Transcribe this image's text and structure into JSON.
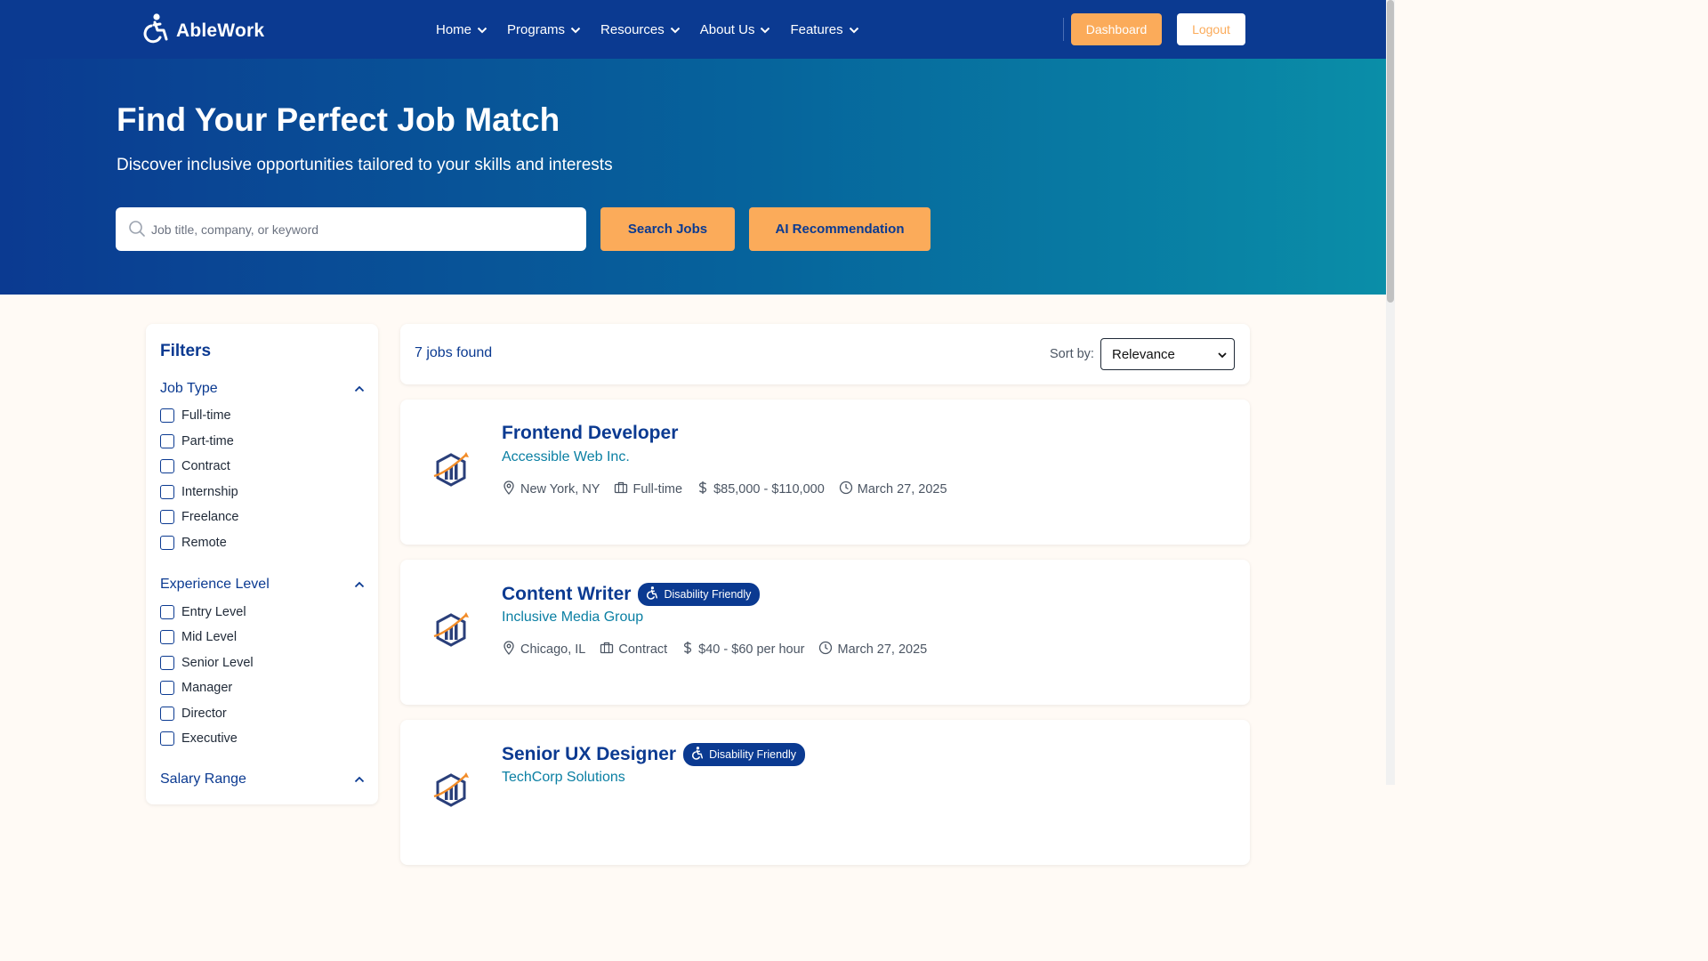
{
  "brand": {
    "name": "AbleWork",
    "icon": "accessibility-icon"
  },
  "nav": {
    "items": [
      {
        "label": "Home"
      },
      {
        "label": "Programs"
      },
      {
        "label": "Resources"
      },
      {
        "label": "About Us"
      },
      {
        "label": "Features"
      }
    ],
    "dashboard_label": "Dashboard",
    "logout_label": "Logout"
  },
  "hero": {
    "title": "Find Your Perfect Job Match",
    "subtitle": "Discover inclusive opportunities tailored to your skills and interests",
    "search_placeholder": "Job title, company, or keyword",
    "search_value": "",
    "search_button": "Search Jobs",
    "ai_button": "AI Recommendation"
  },
  "filters": {
    "title": "Filters",
    "groups": [
      {
        "title": "Job Type",
        "options": [
          "Full-time",
          "Part-time",
          "Contract",
          "Internship",
          "Freelance",
          "Remote"
        ]
      },
      {
        "title": "Experience Level",
        "options": [
          "Entry Level",
          "Mid Level",
          "Senior Level",
          "Manager",
          "Director",
          "Executive"
        ]
      },
      {
        "title": "Salary Range",
        "options": []
      }
    ]
  },
  "results": {
    "count_text": "7 jobs found",
    "sort_label": "Sort by:",
    "sort_value": "Relevance"
  },
  "jobs": [
    {
      "title": "Frontend Developer",
      "badge": "",
      "company": "Accessible Web Inc.",
      "location": "New York, NY",
      "type": "Full-time",
      "salary": "$85,000 - $110,000",
      "date": "March 27, 2025"
    },
    {
      "title": "Content Writer",
      "badge": "Disability Friendly",
      "company": "Inclusive Media Group",
      "location": "Chicago, IL",
      "type": "Contract",
      "salary": "$40 - $60 per hour",
      "date": "March 27, 2025"
    },
    {
      "title": "Senior UX Designer",
      "badge": "Disability Friendly",
      "company": "TechCorp Solutions",
      "location": "",
      "type": "",
      "salary": "",
      "date": ""
    }
  ],
  "colors": {
    "primary": "#0b3a91",
    "accent": "#fbab5a",
    "link": "#0a7fa3",
    "background": "#fffaf5"
  }
}
